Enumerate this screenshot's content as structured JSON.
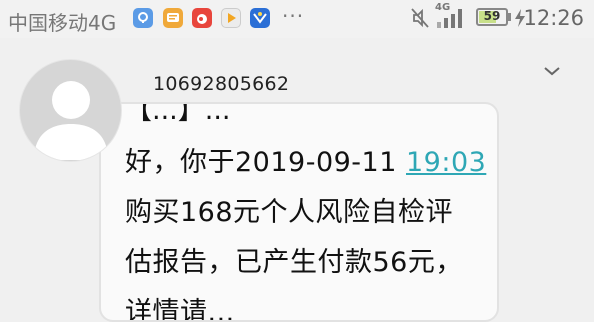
{
  "status_bar": {
    "carrier": "中国移动4G",
    "battery_level": "59",
    "clock": "12:26",
    "notification_icons": [
      "location-icon",
      "message-app-icon",
      "weibo-icon",
      "video-app-icon",
      "news-app-icon"
    ],
    "more": "···",
    "network_label": "4G"
  },
  "conversation": {
    "sender": "10692805662"
  },
  "message": {
    "line_partial": "【...】...",
    "line1_before": "好，你于2019-09-11 ",
    "line1_time": "19:03",
    "line2": "购买168元个人风险自检评",
    "line3": "估报告，已产生付款56元，",
    "line4_partial": "详情请..."
  },
  "colors": {
    "link": "#2ea7b5",
    "background": "#f0f0f0",
    "bubble": "#fafafa"
  }
}
